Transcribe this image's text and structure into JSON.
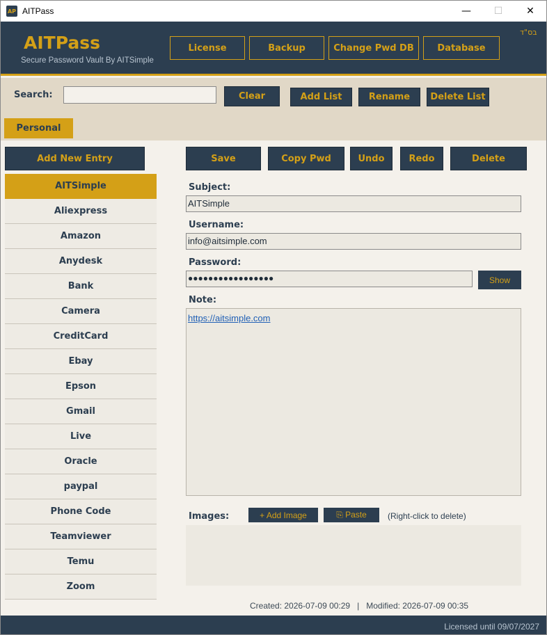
{
  "window": {
    "icon_text": "AP",
    "title": "AITPass",
    "minimize_glyph": "—",
    "maximize_glyph": "☐",
    "close_glyph": "✕"
  },
  "header": {
    "brand": "AITPass",
    "tagline": "Secure Password Vault By AITSimple",
    "hebrew_mark": "בס\"ד",
    "buttons": {
      "license": "License",
      "backup": "Backup",
      "change_pwd_db": "Change Pwd DB",
      "database": "Database"
    }
  },
  "search": {
    "label": "Search:",
    "value": "",
    "clear": "Clear",
    "add_list": "Add List",
    "rename": "Rename",
    "delete_list": "Delete List"
  },
  "lists": {
    "active_tab": "Personal"
  },
  "entries": {
    "add_new": "Add New Entry",
    "items": [
      "AITSimple",
      "Aliexpress",
      "Amazon",
      "Anydesk",
      "Bank",
      "Camera",
      "CreditCard",
      "Ebay",
      "Epson",
      "Gmail",
      "Live",
      "Oracle",
      "paypal",
      "Phone Code",
      "Teamviewer",
      "Temu",
      "Zoom"
    ],
    "selected_index": 0
  },
  "toolbar": {
    "save": "Save",
    "copy_pwd": "Copy Pwd",
    "undo": "Undo",
    "redo": "Redo",
    "delete": "Delete"
  },
  "entry": {
    "subject_label": "Subject:",
    "subject": "AITSimple",
    "username_label": "Username:",
    "username": "info@aitsimple.com",
    "password_label": "Password:",
    "password_masked": "●●●●●●●●●●●●●●●●●",
    "show": "Show",
    "note_label": "Note:",
    "note_link": "https://aitsimple.com",
    "images_label": "Images:",
    "add_image": "+ Add Image",
    "paste": "⎘ Paste",
    "images_hint": "(Right-click to delete)",
    "created": "Created: 2026-07-09 00:29",
    "separator": "|",
    "modified": "Modified: 2026-07-09 00:35"
  },
  "footer": {
    "license_status": "Licensed until 09/07/2027"
  },
  "colors": {
    "navy": "#2c3e50",
    "gold": "#d4a017",
    "cream": "#f4f1eb",
    "band": "#e1d8c7"
  }
}
